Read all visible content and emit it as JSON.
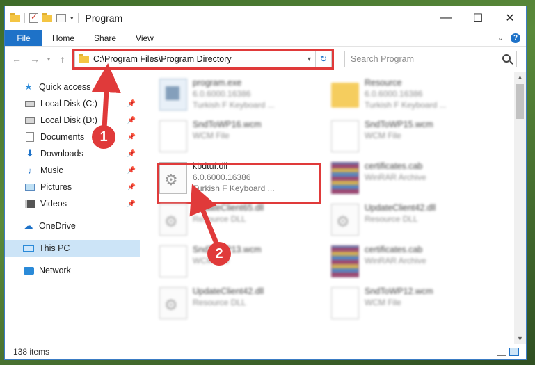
{
  "window": {
    "title": "Program"
  },
  "ribbon": {
    "tabs": [
      "File",
      "Home",
      "Share",
      "View"
    ]
  },
  "address": {
    "path": "C:\\Program Files\\Program Directory"
  },
  "search": {
    "placeholder": "Search Program"
  },
  "sidebar": {
    "quick_access": "Quick access",
    "items": [
      "Local Disk (C:)",
      "Local Disk (D:)",
      "Documents",
      "Downloads",
      "Music",
      "Pictures",
      "Videos"
    ],
    "onedrive": "OneDrive",
    "thispc": "This PC",
    "network": "Network"
  },
  "files": [
    {
      "name": "program.exe",
      "line1": "6.0.6000.16386",
      "line2": "Turkish F Keyboard ...",
      "icon": "exe-icon"
    },
    {
      "name": "Resource",
      "line1": "6.0.6000.16386",
      "line2": "Turkish F Keyboard ...",
      "icon": "folder-icon"
    },
    {
      "name": "SndToWP16.wcm",
      "line1": "WCM File",
      "line2": "",
      "icon": "document-icon"
    },
    {
      "name": "SndToWP15.wcm",
      "line1": "WCM File",
      "line2": "",
      "icon": "document-icon"
    },
    {
      "name": "kbdtuf.dll",
      "line1": "6.0.6000.16386",
      "line2": "Turkish F Keyboard ...",
      "icon": "dll-icon"
    },
    {
      "name": "certificates.cab",
      "line1": "WinRAR Archive",
      "line2": "",
      "icon": "winrar-icon"
    },
    {
      "name": "UpdateClient65.dll",
      "line1": "Resource DLL",
      "line2": "",
      "icon": "dll-icon"
    },
    {
      "name": "UpdateClient42.dll",
      "line1": "Resource DLL",
      "line2": "",
      "icon": "dll-icon"
    },
    {
      "name": "SndToWP13.wcm",
      "line1": "WCM File",
      "line2": "",
      "icon": "document-icon"
    },
    {
      "name": "certificates.cab",
      "line1": "WinRAR Archive",
      "line2": "",
      "icon": "winrar-icon"
    },
    {
      "name": "UpdateClient42.dll",
      "line1": "Resource DLL",
      "line2": "",
      "icon": "dll-icon"
    },
    {
      "name": "SndToWP12.wcm",
      "line1": "WCM File",
      "line2": "",
      "icon": "document-icon"
    }
  ],
  "markers": {
    "one": "1",
    "two": "2"
  },
  "status": {
    "count": "138 items"
  },
  "colors": {
    "accent": "#1e72c8",
    "highlight": "#e03a3a",
    "selected": "#cce4f7"
  }
}
